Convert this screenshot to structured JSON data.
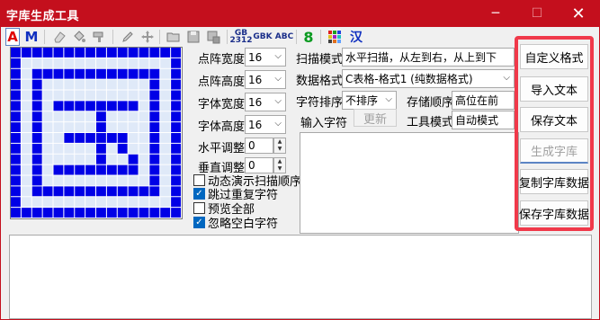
{
  "window": {
    "title": "字库生成工具",
    "min_glyph": "─",
    "max_glyph": "☐",
    "close_glyph": "✕"
  },
  "toolbar": {
    "text_color_label": "A",
    "mode_label": "M",
    "eraser_icon": "eraser-icon",
    "fill_icon": "bucket-icon",
    "paint_icon": "brush-icon",
    "pencil_icon": "pencil-icon",
    "move_icon": "move-icon",
    "open_icon": "folder-open-icon",
    "save_icon": "floppy-disk-icon",
    "save_as_icon": "floppy-save-as-icon",
    "gb2312_label": "GB 2312",
    "gbk_label": "GBK",
    "abc_label": "ABC",
    "digit_label": "8",
    "palette_icon": "color-grid-icon",
    "han_label": "汉"
  },
  "settings": {
    "dot_width_label": "点阵宽度",
    "dot_width_value": "16",
    "dot_height_label": "点阵高度",
    "dot_height_value": "16",
    "font_width_label": "字体宽度",
    "font_width_value": "16",
    "font_height_label": "字体高度",
    "font_height_value": "16",
    "h_adjust_label": "水平调整",
    "h_adjust_value": "0",
    "v_adjust_label": "垂直调整",
    "v_adjust_value": "0",
    "scan_mode_label": "扫描模式",
    "scan_mode_value": "水平扫描，从左到右，从上到下",
    "data_format_label": "数据格式",
    "data_format_value": "C表格-格式1 (纯数据格式)",
    "char_sort_label": "字符排序",
    "char_sort_value": "不排序",
    "storage_order_label": "存储顺序",
    "storage_order_value": "高位在前",
    "input_chars_label": "输入字符",
    "refresh_label": "更新",
    "tool_mode_label": "工具模式",
    "tool_mode_value": "自动模式"
  },
  "options": [
    {
      "label": "动态演示扫描顺序",
      "checked": false
    },
    {
      "label": "跳过重复字符",
      "checked": true
    },
    {
      "label": "预览全部",
      "checked": false
    },
    {
      "label": "忽略空白字符",
      "checked": true
    }
  ],
  "side_buttons": {
    "custom_format": "自定义格式",
    "import_text": "导入文本",
    "save_text": "保存文本",
    "generate_font": "生成字库",
    "copy_font_data": "复制字库数据",
    "save_font_data": "保存字库数据"
  },
  "glyph_preview": {
    "rows": [
      "1111111111111111",
      "1000000000000001",
      "1011111111111101",
      "1010000000000101",
      "1010000000000101",
      "1010111111110101",
      "1010000010000101",
      "1010000010000101",
      "1010011111100101",
      "1010000010100101",
      "1010000010010101",
      "1010111111110101",
      "1010000000000101",
      "1011111111111101",
      "1000000000000001",
      "1111111111111111"
    ],
    "on_color": "#0000e6",
    "off_color": "#dfe9f8",
    "grid_color": "#9bb4dd"
  },
  "colors": {
    "title_bar": "#c40f1d",
    "highlight": "#f0394a",
    "checkbox": "#0067c0"
  }
}
